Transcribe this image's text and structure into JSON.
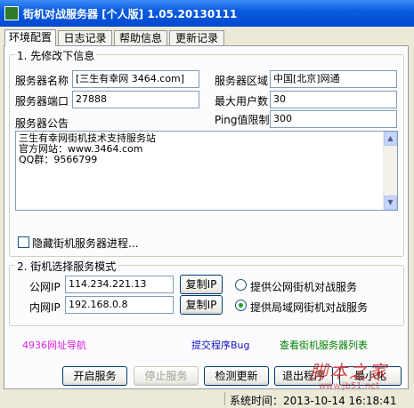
{
  "window": {
    "title": "街机对战服务器 [个人版] 1.05.20130111"
  },
  "tabs": [
    {
      "label": "环境配置",
      "active": true
    },
    {
      "label": "日志记录",
      "active": false
    },
    {
      "label": "帮助信息",
      "active": false
    },
    {
      "label": "更新记录",
      "active": false
    }
  ],
  "group1": {
    "legend": "1. 先修改下信息",
    "server_name_label": "服务器名称",
    "server_name_value": "[三生有幸网 3464.com]",
    "server_region_label": "服务器区域",
    "server_region_value": "中国[北京]网通",
    "server_port_label": "服务器端口",
    "server_port_value": "27888",
    "max_users_label": "最大用户数",
    "max_users_value": "30",
    "ping_limit_label": "Ping值限制",
    "ping_limit_value": "300",
    "notice_label": "服务器公告",
    "notice_text": "三生有幸网街机技术支持服务站\n官方网站：www.3464.com\nQQ群：9566799",
    "hide_process_label": "隐藏街机服务器进程..."
  },
  "group2": {
    "legend": "2. 街机选择服务模式",
    "public_ip_label": "公网IP",
    "public_ip_value": "114.234.221.13",
    "lan_ip_label": "内网IP",
    "lan_ip_value": "192.168.0.8",
    "copy_ip_label": "复制IP",
    "public_service_label": "提供公网街机对战服务",
    "lan_service_label": "提供局域网街机对战服务",
    "selected_mode": "lan"
  },
  "links": {
    "nav": "4936网址导航",
    "submit_bug": "提交程序Bug",
    "view_servers": "查看街机服务器列表"
  },
  "links_colors": {
    "nav": "#e020e0",
    "submit_bug": "#1010c0",
    "view_servers": "#008000"
  },
  "buttons": {
    "start": "开启服务",
    "stop": "停止服务",
    "check_update": "检测更新",
    "exit": "退出程序",
    "minimize": "最小化"
  },
  "status": {
    "time": "系统时间：2013-10-14  16:18:41"
  },
  "watermark": {
    "big": "脚本之家",
    "small": "www.jb51.net"
  }
}
